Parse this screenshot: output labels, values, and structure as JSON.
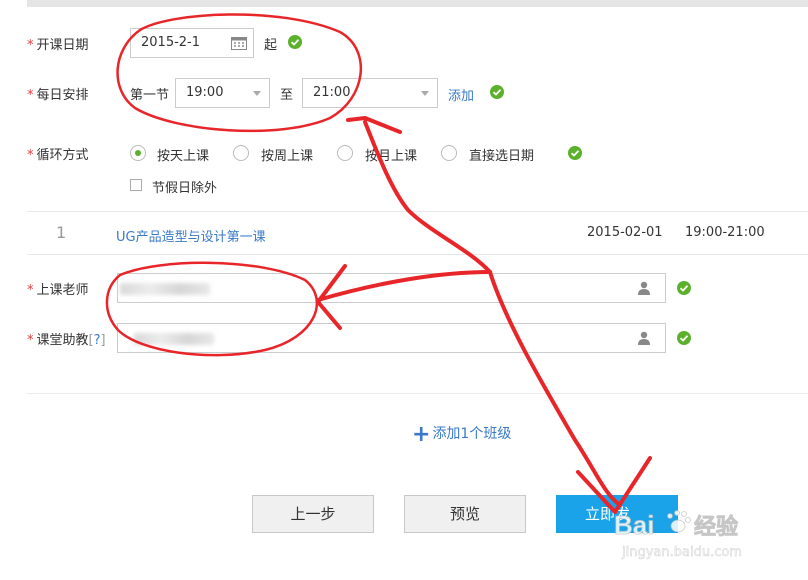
{
  "form": {
    "start_date": {
      "label": "开课日期",
      "value": "2015-2-1",
      "suffix": "起"
    },
    "schedule": {
      "label": "每日安排",
      "section_label": "第一节",
      "start_time": "19:00",
      "separator": "至",
      "end_time": "21:00",
      "add_link": "添加"
    },
    "cycle": {
      "label": "循环方式",
      "options": [
        {
          "label": "按天上课",
          "checked": true
        },
        {
          "label": "按周上课",
          "checked": false
        },
        {
          "label": "按月上课",
          "checked": false
        },
        {
          "label": "直接选日期",
          "checked": false
        }
      ],
      "exclude_holidays": "节假日除外"
    },
    "lessons": [
      {
        "index": "1",
        "title": "UG产品造型与设计第一课",
        "date": "2015-02-01",
        "time": "19:00-21:00"
      }
    ],
    "teacher": {
      "label": "上课老师"
    },
    "assistant": {
      "label": "课堂助教",
      "help_open": "[",
      "help": "?",
      "help_close": "]"
    },
    "add_class": "添加1个班级"
  },
  "buttons": {
    "prev": "上一步",
    "preview": "预览",
    "publish": "立即发"
  },
  "watermark": {
    "text": "Bai",
    "sub": "经验",
    "url": "jingyan.baidu.com"
  },
  "colors": {
    "required": "#e4393c",
    "link": "#3a79c9",
    "check": "#5bb02c",
    "primary": "#1aa3e8",
    "annotation": "#e8262a"
  }
}
